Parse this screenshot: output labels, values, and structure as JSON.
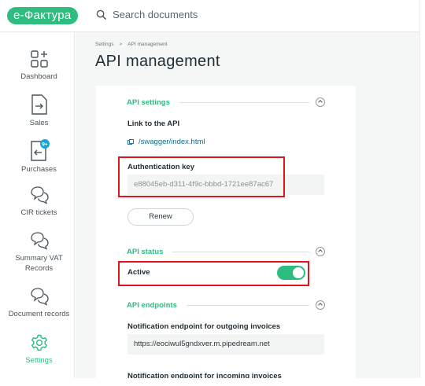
{
  "app": {
    "logo": "е-Фактура"
  },
  "search": {
    "placeholder": "Search documents"
  },
  "sidebar": {
    "items": [
      {
        "label": "Dashboard"
      },
      {
        "label": "Sales"
      },
      {
        "label": "Purchases",
        "badge": "9+"
      },
      {
        "label": "CIR tickets"
      },
      {
        "label": "Summary VAT\nRecords"
      },
      {
        "label": "Document records"
      },
      {
        "label": "Settings"
      }
    ]
  },
  "breadcrumb": {
    "root": "Settings",
    "separator": ">",
    "current": "API management"
  },
  "page": {
    "title": "API management"
  },
  "api_settings": {
    "heading": "API settings",
    "link_label": "Link to the API",
    "link_text": "/swagger/index.html",
    "auth_label": "Authentication key",
    "auth_value": "e88045eb-d311-4f9c-bbbd-1721ee87ac67",
    "renew_label": "Renew"
  },
  "api_status": {
    "heading": "API status",
    "active_label": "Active",
    "active_on": true
  },
  "api_endpoints": {
    "heading": "API endpoints",
    "outgoing_label": "Notification endpoint for outgoing invoices",
    "outgoing_value": "https://eociwul5gndxver.m.pipedream.net",
    "incoming_label": "Notification endpoint for incoming invoices"
  },
  "colors": {
    "accent": "#2dbd80",
    "highlight": "#e2141b",
    "link": "#0f6d8a"
  }
}
